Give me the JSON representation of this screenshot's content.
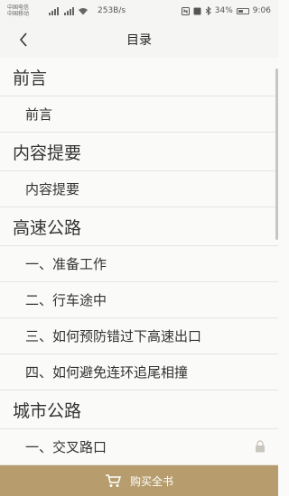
{
  "status_bar": {
    "carrier1": "中国电信",
    "carrier2": "中国移动",
    "speed": "253B/s",
    "battery": "34%",
    "time": "9:06"
  },
  "header": {
    "title": "目录"
  },
  "toc": [
    {
      "type": "section",
      "label": "前言"
    },
    {
      "type": "chapter",
      "label": "前言"
    },
    {
      "type": "section",
      "label": "内容提要"
    },
    {
      "type": "chapter",
      "label": "内容提要"
    },
    {
      "type": "section",
      "label": "高速公路"
    },
    {
      "type": "chapter",
      "label": "一、准备工作"
    },
    {
      "type": "chapter",
      "label": "二、行车途中"
    },
    {
      "type": "chapter",
      "label": "三、如何预防错过下高速出口"
    },
    {
      "type": "chapter",
      "label": "四、如何避免连环追尾相撞"
    },
    {
      "type": "section",
      "label": "城市公路"
    },
    {
      "type": "chapter",
      "label": "一、交叉路口",
      "locked": true
    }
  ],
  "buy_bar": {
    "label": "购买全书",
    "icon": "cart-icon"
  },
  "colors": {
    "accent": "#b79d6e"
  }
}
